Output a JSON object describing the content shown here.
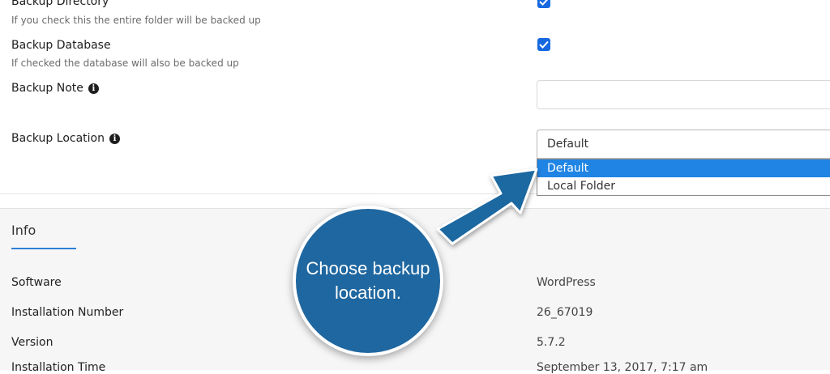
{
  "form": {
    "backup_directory": {
      "label": "Backup Directory",
      "hint": "If you check this the entire folder will be backed up",
      "checked": true
    },
    "backup_database": {
      "label": "Backup Database",
      "hint": "If checked the database will also be backed up",
      "checked": true
    },
    "backup_note": {
      "label": "Backup Note",
      "value": ""
    },
    "backup_location": {
      "label": "Backup Location",
      "selected": "Default",
      "options": [
        "Default",
        "Local Folder"
      ]
    }
  },
  "info": {
    "title": "Info",
    "rows": [
      {
        "key": "Software",
        "value": "WordPress"
      },
      {
        "key": "Installation Number",
        "value": "26_67019"
      },
      {
        "key": "Version",
        "value": "5.7.2"
      },
      {
        "key": "Installation Time",
        "value": "September 13, 2017, 7:17 am"
      }
    ]
  },
  "callout": {
    "line1": "Choose backup",
    "line2": "location."
  },
  "colors": {
    "accent": "#1769e0",
    "highlight": "#1f84e4",
    "callout": "#1f67a0"
  }
}
